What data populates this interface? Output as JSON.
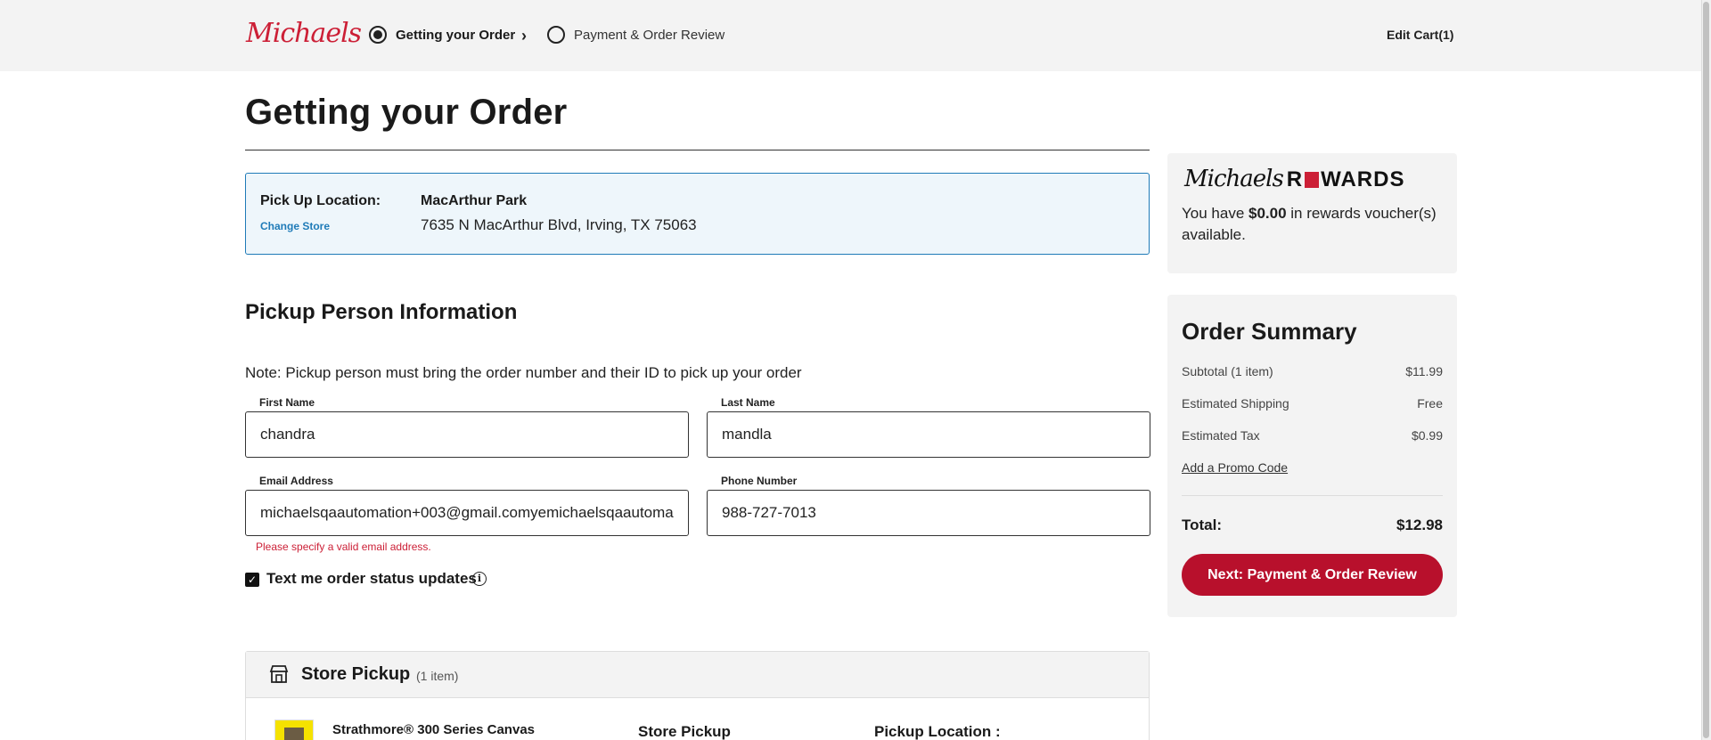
{
  "header": {
    "logo": "Michaels",
    "steps": [
      {
        "label": "Getting your Order",
        "active": true
      },
      {
        "label": "Payment & Order Review",
        "active": false
      }
    ],
    "edit_cart": "Edit Cart(1)"
  },
  "main": {
    "title": "Getting your Order",
    "pickup": {
      "label": "Pick Up Location:",
      "change_store": "Change Store",
      "store_name": "MacArthur Park",
      "store_address": "7635 N MacArthur Blvd, Irving, TX 75063"
    },
    "person": {
      "title": "Pickup Person Information",
      "note": "Note: Pickup person must bring the order number and their ID to pick up your order",
      "first_name_label": "First Name",
      "first_name_value": "chandra",
      "last_name_label": "Last Name",
      "last_name_value": "mandla",
      "email_label": "Email Address",
      "email_value": "michaelsqaautomation+003@gmail.comyemichaelsqaautoma",
      "email_error": "Please specify a valid email address.",
      "phone_label": "Phone Number",
      "phone_value": "988-727-7013",
      "sms_label": "Text me order status updates",
      "sms_checked": true
    },
    "store_pickup": {
      "title": "Store Pickup",
      "count": "(1 item)",
      "product": "Strathmore® 300 Series Canvas",
      "col2": "Store Pickup",
      "col3": "Pickup Location :"
    }
  },
  "rewards": {
    "logo_script": "Michaels",
    "logo_word_1": "R",
    "logo_word_2": "WARDS",
    "text_before": "You have ",
    "amount": "$0.00",
    "text_after": " in rewards voucher(s) available."
  },
  "summary": {
    "title": "Order Summary",
    "rows": [
      {
        "label": "Subtotal (1 item)",
        "value": "$11.99"
      },
      {
        "label": "Estimated Shipping",
        "value": "Free"
      },
      {
        "label": "Estimated Tax",
        "value": "$0.99"
      }
    ],
    "promo": "Add a Promo Code",
    "total_label": "Total:",
    "total_value": "$12.98",
    "next_button": "Next: Payment & Order Review"
  },
  "colors": {
    "brand_red": "#cc1f36",
    "button_red": "#b8102c",
    "link_blue": "#1f7bb8"
  }
}
